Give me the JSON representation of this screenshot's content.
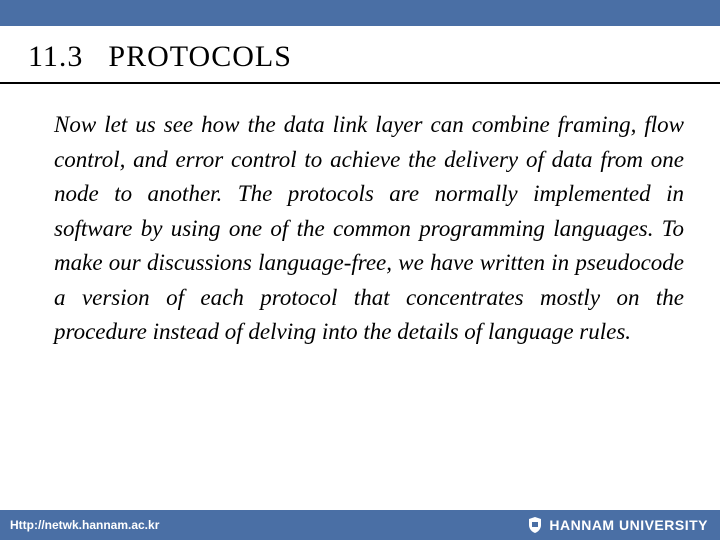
{
  "heading": {
    "section_number": "11.3",
    "title": "PROTOCOLS"
  },
  "body": {
    "paragraph": "Now let us see how the data link layer can combine framing, flow control, and error control to achieve the delivery of data from one node to another. The protocols are normally implemented in software by using one of the common programming languages. To make our discussions language-free, we have written in pseudocode a version of each protocol that concentrates mostly on the procedure instead of delving into the details of language rules."
  },
  "footer": {
    "url": "Http://netwk.hannam.ac.kr",
    "institution": "HANNAM  UNIVERSITY"
  }
}
